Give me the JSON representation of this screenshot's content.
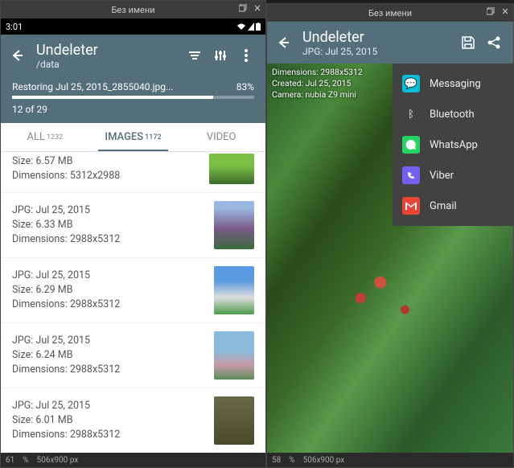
{
  "window1": {
    "title": "Без имени",
    "footer_zoom": "61",
    "footer_pct": "%",
    "footer_size": "506x900 px"
  },
  "window2": {
    "title": "Без имени",
    "footer_zoom": "58",
    "footer_pct": "%",
    "footer_size": "506x900 px"
  },
  "status": {
    "time": "3:01"
  },
  "app1": {
    "title": "Undeleter",
    "subtitle": "/data",
    "restoring": "Restoring Jul 25, 2015_2855040.jpg...",
    "percent": "83%",
    "count": "12 of 29"
  },
  "tabs": {
    "all": "ALL",
    "all_count": "1232",
    "images": "IMAGES",
    "images_count": "1172",
    "video": "VIDEO"
  },
  "items": [
    {
      "line1": "Size: 6.57 MB",
      "line2": "Dimensions: 5312x2988"
    },
    {
      "line1": "JPG: Jul 25, 2015",
      "line2": "Size: 6.33 MB",
      "line3": "Dimensions: 2988x5312"
    },
    {
      "line1": "JPG: Jul 25, 2015",
      "line2": "Size: 6.29 MB",
      "line3": "Dimensions: 2988x5312"
    },
    {
      "line1": "JPG: Jul 25, 2015",
      "line2": "Size: 6.24 MB",
      "line3": "Dimensions: 2988x5312"
    },
    {
      "line1": "JPG: Jul 25, 2015",
      "line2": "Size: 6.01 MB",
      "line3": "Dimensions: 2988x5312"
    }
  ],
  "app2": {
    "title": "Undeleter",
    "subtitle": "JPG: Jul 25, 2015",
    "meta1": "Dimensions: 2988x5312",
    "meta2": "Created: Jul 25, 2015",
    "meta3": "Camera: nubia Z9 mini"
  },
  "share": {
    "messaging": "Messaging",
    "bluetooth": "Bluetooth",
    "whatsapp": "WhatsApp",
    "viber": "Viber",
    "gmail": "Gmail"
  }
}
